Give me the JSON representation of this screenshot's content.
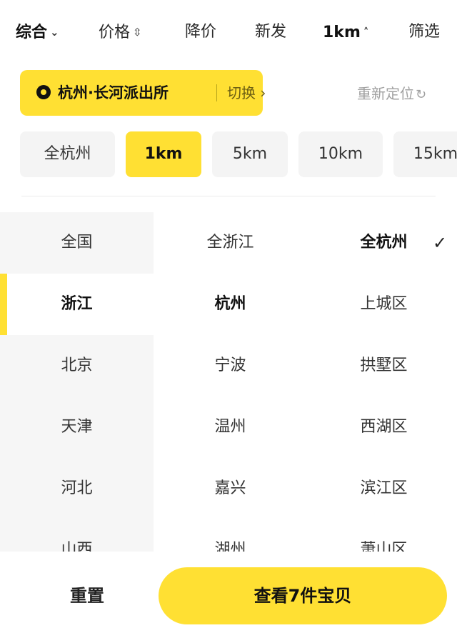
{
  "sort_bar": {
    "items": [
      {
        "label": "综合",
        "arrow": "⌄"
      },
      {
        "label": "价格",
        "arrow": "⇳"
      },
      {
        "label": "降价",
        "arrow": ""
      },
      {
        "label": "新发",
        "arrow": ""
      },
      {
        "label": "1km",
        "arrow": "˄"
      },
      {
        "label": "筛选",
        "arrow": ""
      }
    ]
  },
  "location": {
    "current": "杭州·长河派出所",
    "switch_label": "切换 ›",
    "relocate_label": "重新定位",
    "pin_icon": "location-pin-icon",
    "refresh_icon": "refresh-icon",
    "accent_color": "#ffe033"
  },
  "distance_chips": [
    {
      "label": "全杭州"
    },
    {
      "label": "1km"
    },
    {
      "label": "5km"
    },
    {
      "label": "10km"
    },
    {
      "label": "15km"
    }
  ],
  "selected_distance": "1km",
  "regions": {
    "provinces": [
      "全国",
      "浙江",
      "北京",
      "天津",
      "河北",
      "山西"
    ],
    "cities": [
      "全浙江",
      "杭州",
      "宁波",
      "温州",
      "嘉兴",
      "湖州"
    ],
    "districts": [
      "全杭州",
      "上城区",
      "拱墅区",
      "西湖区",
      "滨江区",
      "萧山区"
    ],
    "selected_province": "浙江",
    "selected_city": "杭州",
    "selected_district": "全杭州",
    "check_icon": "✓"
  },
  "actions": {
    "reset_label": "重置",
    "view_label": "查看7件宝贝"
  }
}
